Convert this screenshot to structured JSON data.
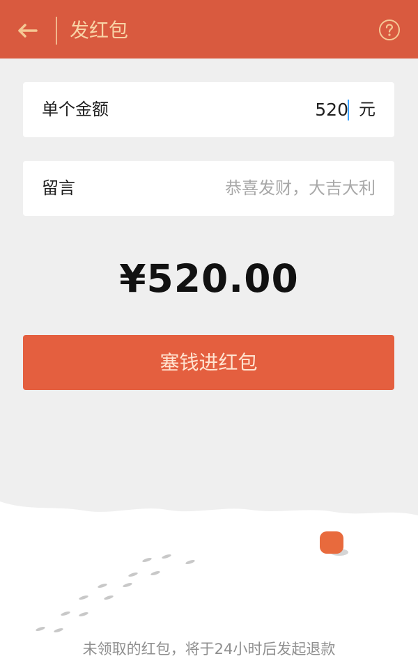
{
  "header": {
    "title": "发红包",
    "back_icon": "back-arrow-icon",
    "help_icon": "question-mark-icon",
    "bg_color": "#d95a3f",
    "title_color": "#f8d3a6"
  },
  "form": {
    "amount": {
      "label": "单个金额",
      "value": "520",
      "unit": "元"
    },
    "message": {
      "label": "留言",
      "placeholder": "恭喜发财，大吉大利"
    }
  },
  "total": "¥520.00",
  "submit_label": "塞钱进红包",
  "footer_note": "未领取的红包，将于24小时后发起退款",
  "colors": {
    "accent": "#e45f3f",
    "background": "#efefef",
    "card": "#ffffff"
  }
}
